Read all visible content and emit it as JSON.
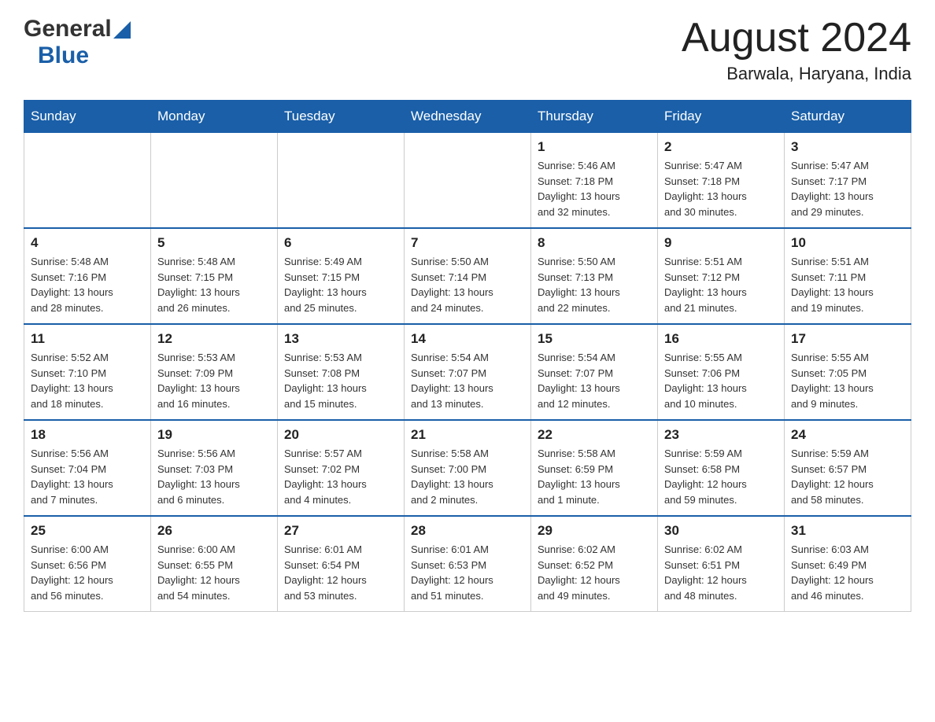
{
  "header": {
    "logo_general": "General",
    "logo_blue": "Blue",
    "month_title": "August 2024",
    "location": "Barwala, Haryana, India"
  },
  "weekdays": [
    "Sunday",
    "Monday",
    "Tuesday",
    "Wednesday",
    "Thursday",
    "Friday",
    "Saturday"
  ],
  "weeks": [
    [
      {
        "day": "",
        "info": ""
      },
      {
        "day": "",
        "info": ""
      },
      {
        "day": "",
        "info": ""
      },
      {
        "day": "",
        "info": ""
      },
      {
        "day": "1",
        "info": "Sunrise: 5:46 AM\nSunset: 7:18 PM\nDaylight: 13 hours\nand 32 minutes."
      },
      {
        "day": "2",
        "info": "Sunrise: 5:47 AM\nSunset: 7:18 PM\nDaylight: 13 hours\nand 30 minutes."
      },
      {
        "day": "3",
        "info": "Sunrise: 5:47 AM\nSunset: 7:17 PM\nDaylight: 13 hours\nand 29 minutes."
      }
    ],
    [
      {
        "day": "4",
        "info": "Sunrise: 5:48 AM\nSunset: 7:16 PM\nDaylight: 13 hours\nand 28 minutes."
      },
      {
        "day": "5",
        "info": "Sunrise: 5:48 AM\nSunset: 7:15 PM\nDaylight: 13 hours\nand 26 minutes."
      },
      {
        "day": "6",
        "info": "Sunrise: 5:49 AM\nSunset: 7:15 PM\nDaylight: 13 hours\nand 25 minutes."
      },
      {
        "day": "7",
        "info": "Sunrise: 5:50 AM\nSunset: 7:14 PM\nDaylight: 13 hours\nand 24 minutes."
      },
      {
        "day": "8",
        "info": "Sunrise: 5:50 AM\nSunset: 7:13 PM\nDaylight: 13 hours\nand 22 minutes."
      },
      {
        "day": "9",
        "info": "Sunrise: 5:51 AM\nSunset: 7:12 PM\nDaylight: 13 hours\nand 21 minutes."
      },
      {
        "day": "10",
        "info": "Sunrise: 5:51 AM\nSunset: 7:11 PM\nDaylight: 13 hours\nand 19 minutes."
      }
    ],
    [
      {
        "day": "11",
        "info": "Sunrise: 5:52 AM\nSunset: 7:10 PM\nDaylight: 13 hours\nand 18 minutes."
      },
      {
        "day": "12",
        "info": "Sunrise: 5:53 AM\nSunset: 7:09 PM\nDaylight: 13 hours\nand 16 minutes."
      },
      {
        "day": "13",
        "info": "Sunrise: 5:53 AM\nSunset: 7:08 PM\nDaylight: 13 hours\nand 15 minutes."
      },
      {
        "day": "14",
        "info": "Sunrise: 5:54 AM\nSunset: 7:07 PM\nDaylight: 13 hours\nand 13 minutes."
      },
      {
        "day": "15",
        "info": "Sunrise: 5:54 AM\nSunset: 7:07 PM\nDaylight: 13 hours\nand 12 minutes."
      },
      {
        "day": "16",
        "info": "Sunrise: 5:55 AM\nSunset: 7:06 PM\nDaylight: 13 hours\nand 10 minutes."
      },
      {
        "day": "17",
        "info": "Sunrise: 5:55 AM\nSunset: 7:05 PM\nDaylight: 13 hours\nand 9 minutes."
      }
    ],
    [
      {
        "day": "18",
        "info": "Sunrise: 5:56 AM\nSunset: 7:04 PM\nDaylight: 13 hours\nand 7 minutes."
      },
      {
        "day": "19",
        "info": "Sunrise: 5:56 AM\nSunset: 7:03 PM\nDaylight: 13 hours\nand 6 minutes."
      },
      {
        "day": "20",
        "info": "Sunrise: 5:57 AM\nSunset: 7:02 PM\nDaylight: 13 hours\nand 4 minutes."
      },
      {
        "day": "21",
        "info": "Sunrise: 5:58 AM\nSunset: 7:00 PM\nDaylight: 13 hours\nand 2 minutes."
      },
      {
        "day": "22",
        "info": "Sunrise: 5:58 AM\nSunset: 6:59 PM\nDaylight: 13 hours\nand 1 minute."
      },
      {
        "day": "23",
        "info": "Sunrise: 5:59 AM\nSunset: 6:58 PM\nDaylight: 12 hours\nand 59 minutes."
      },
      {
        "day": "24",
        "info": "Sunrise: 5:59 AM\nSunset: 6:57 PM\nDaylight: 12 hours\nand 58 minutes."
      }
    ],
    [
      {
        "day": "25",
        "info": "Sunrise: 6:00 AM\nSunset: 6:56 PM\nDaylight: 12 hours\nand 56 minutes."
      },
      {
        "day": "26",
        "info": "Sunrise: 6:00 AM\nSunset: 6:55 PM\nDaylight: 12 hours\nand 54 minutes."
      },
      {
        "day": "27",
        "info": "Sunrise: 6:01 AM\nSunset: 6:54 PM\nDaylight: 12 hours\nand 53 minutes."
      },
      {
        "day": "28",
        "info": "Sunrise: 6:01 AM\nSunset: 6:53 PM\nDaylight: 12 hours\nand 51 minutes."
      },
      {
        "day": "29",
        "info": "Sunrise: 6:02 AM\nSunset: 6:52 PM\nDaylight: 12 hours\nand 49 minutes."
      },
      {
        "day": "30",
        "info": "Sunrise: 6:02 AM\nSunset: 6:51 PM\nDaylight: 12 hours\nand 48 minutes."
      },
      {
        "day": "31",
        "info": "Sunrise: 6:03 AM\nSunset: 6:49 PM\nDaylight: 12 hours\nand 46 minutes."
      }
    ]
  ]
}
